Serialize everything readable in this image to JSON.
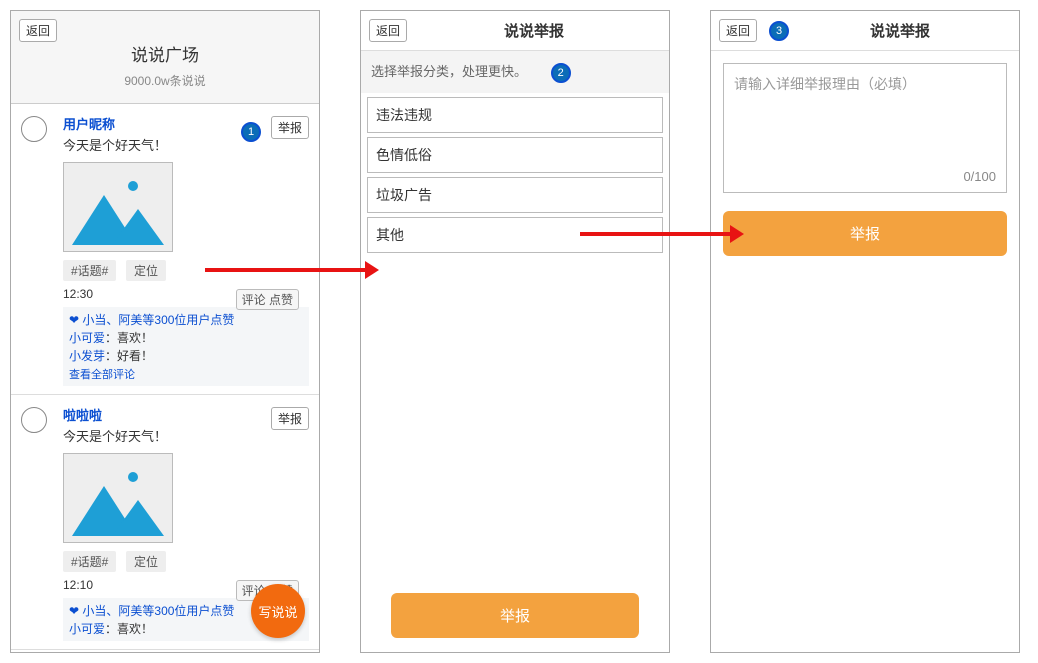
{
  "common": {
    "back_label": "返回",
    "report_btn": "举报",
    "comment_like": "评论 点赞",
    "topic_chip": "#话题#",
    "location_chip": "定位",
    "view_all_comments": "查看全部评论",
    "fab_label": "写说说"
  },
  "s1": {
    "title": "说说广场",
    "subtitle": "9000.0w条说说",
    "posts": [
      {
        "nickname": "用户昵称",
        "content": "今天是个好天气！",
        "time": "12:30",
        "likes_text": "小当、阿美等300位用户点赞",
        "comments": [
          {
            "name": "小可爱",
            "text": "喜欢！"
          },
          {
            "name": "小发芽",
            "text": "好看！"
          }
        ]
      },
      {
        "nickname": "啦啦啦",
        "content": "今天是个好天气！",
        "time": "12:10",
        "likes_text": "小当、阿美等300位用户点赞",
        "comments": [
          {
            "name": "小可爱",
            "text": "喜欢！"
          }
        ]
      }
    ]
  },
  "s2": {
    "title": "说说举报",
    "hint": "选择举报分类，处理更快。",
    "categories": [
      "违法违规",
      "色情低俗",
      "垃圾广告",
      "其他"
    ],
    "submit": "举报"
  },
  "s3": {
    "title": "说说举报",
    "placeholder": "请输入详细举报理由（必填）",
    "counter": "0/100",
    "submit": "举报"
  },
  "steps": {
    "one": "1",
    "two": "2",
    "three": "3"
  }
}
